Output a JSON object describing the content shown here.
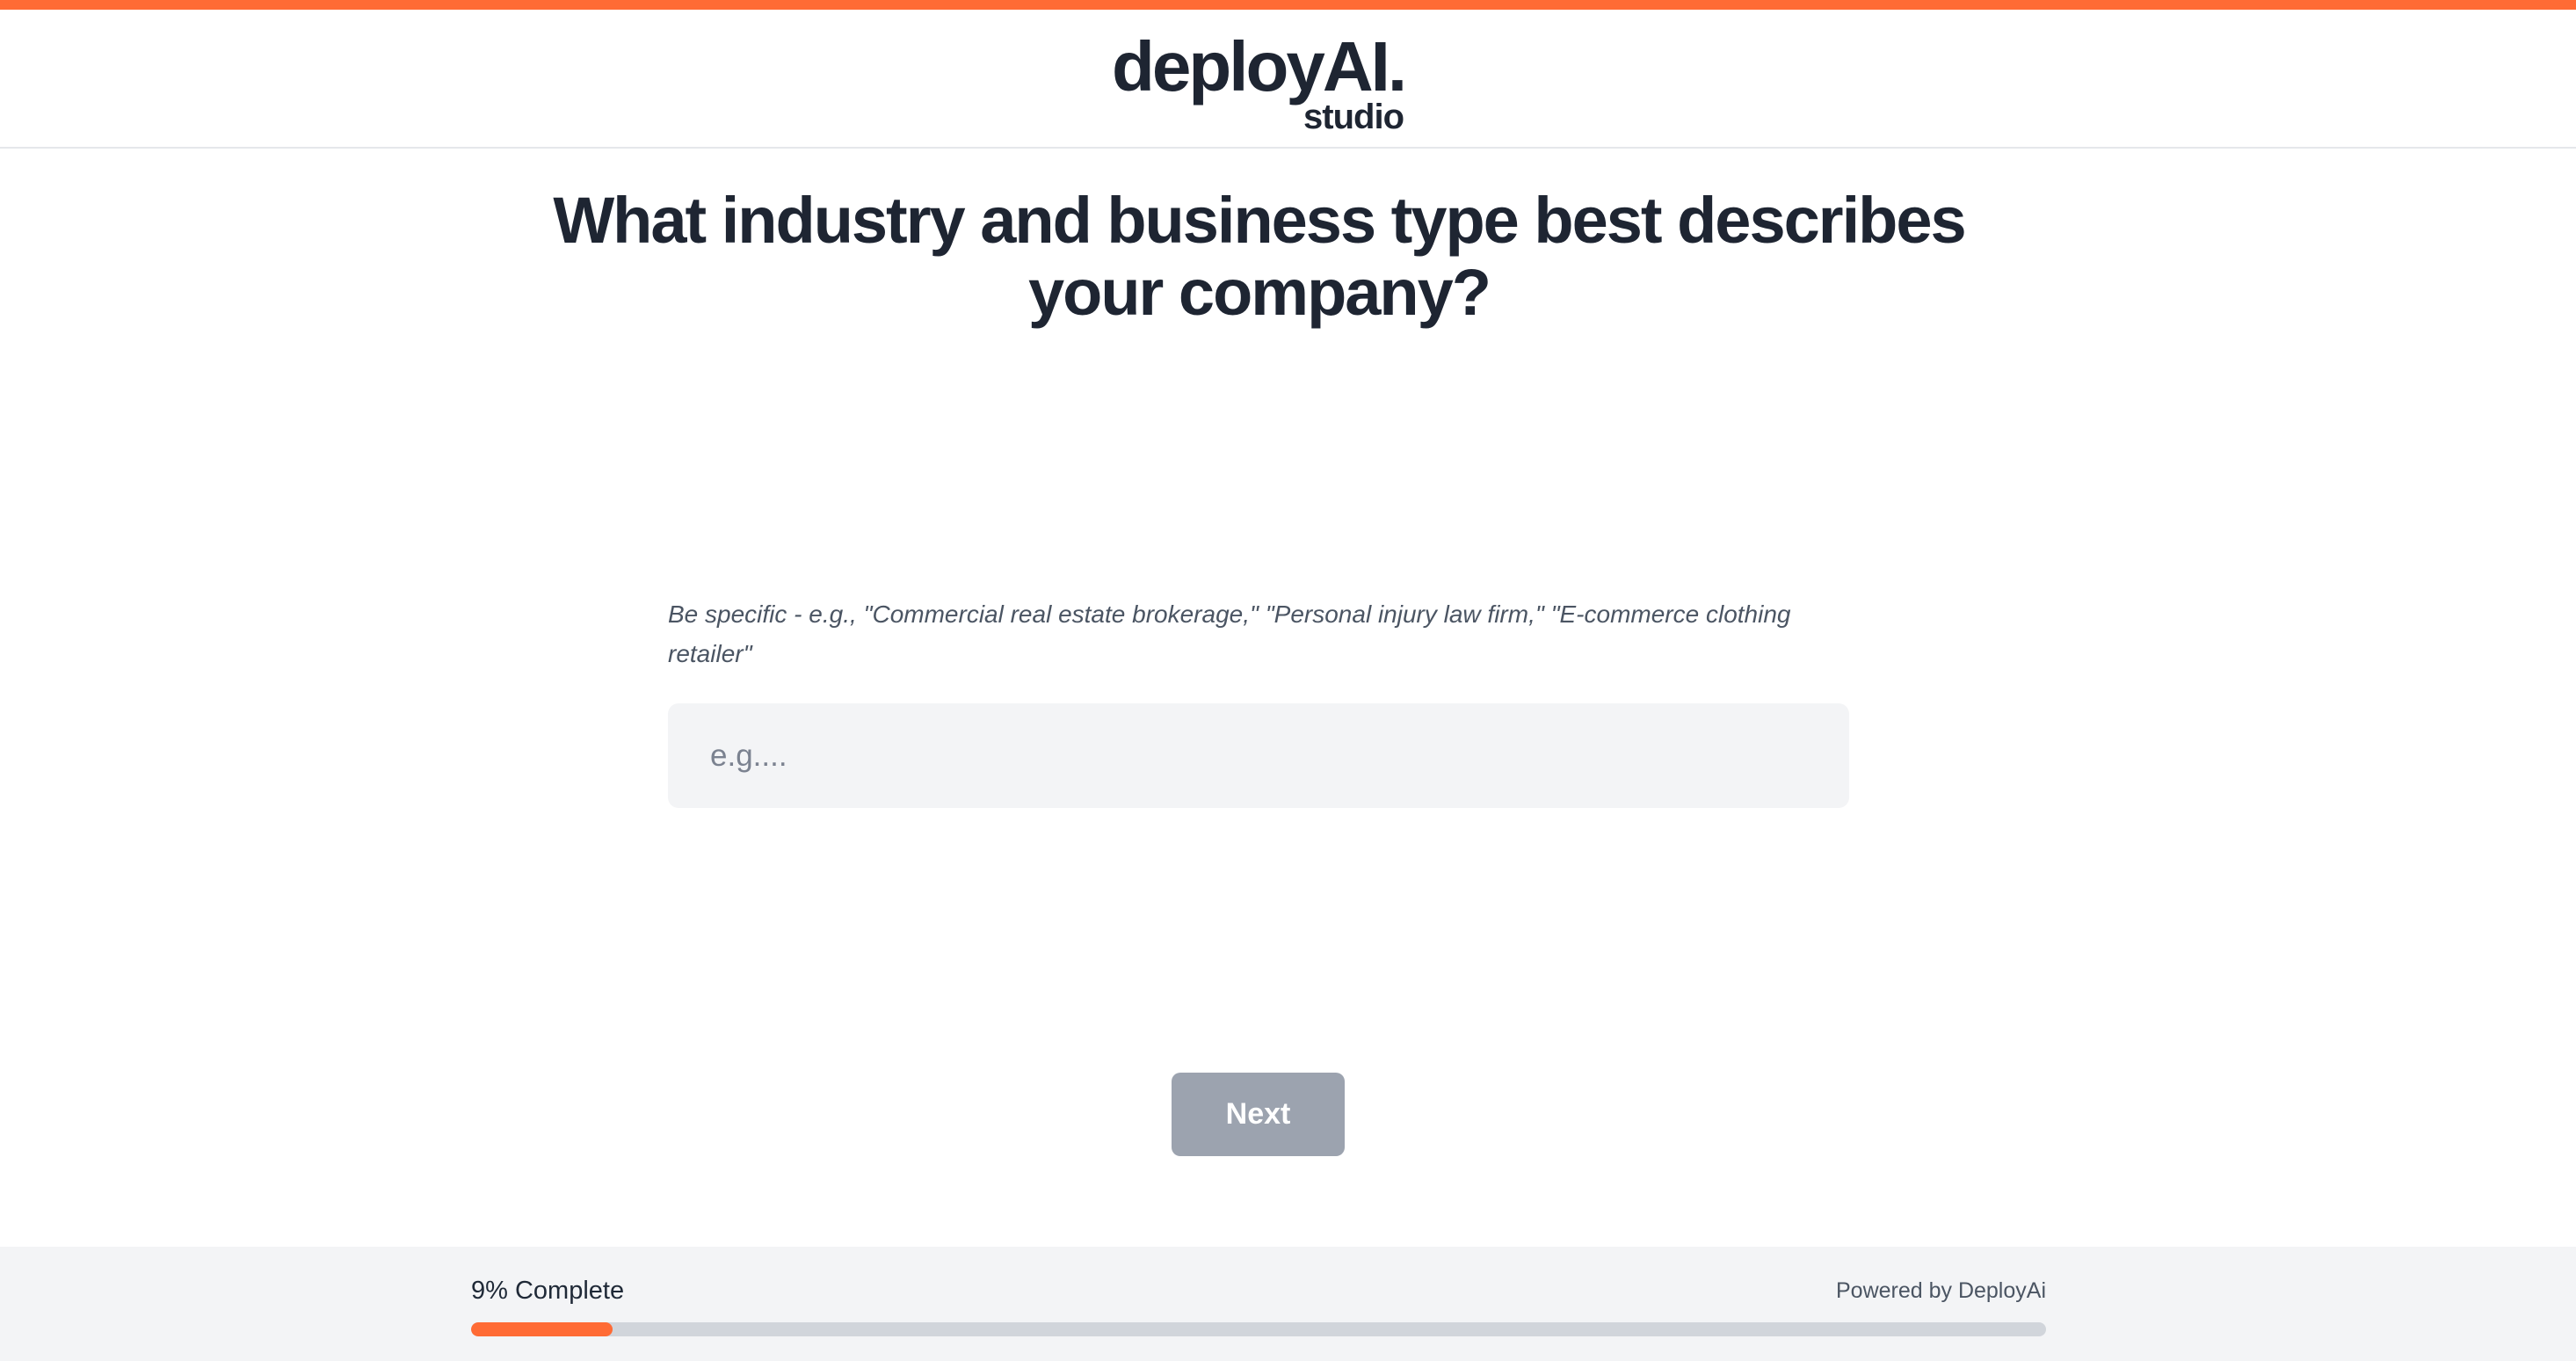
{
  "brand": {
    "name": "deployAI.",
    "sub": "studio",
    "accent_color": "#ff6b35"
  },
  "question": {
    "title": "What industry and business type best describes your company?",
    "hint": "Be specific - e.g., \"Commercial real estate brokerage,\" \"Personal injury law firm,\" \"E-commerce clothing retailer\""
  },
  "answer": {
    "placeholder": "e.g....",
    "value": ""
  },
  "actions": {
    "next_label": "Next",
    "next_color": "#9ca3af"
  },
  "progress": {
    "label": "9% Complete",
    "percent": 9,
    "powered_by": "Powered by DeployAi"
  }
}
